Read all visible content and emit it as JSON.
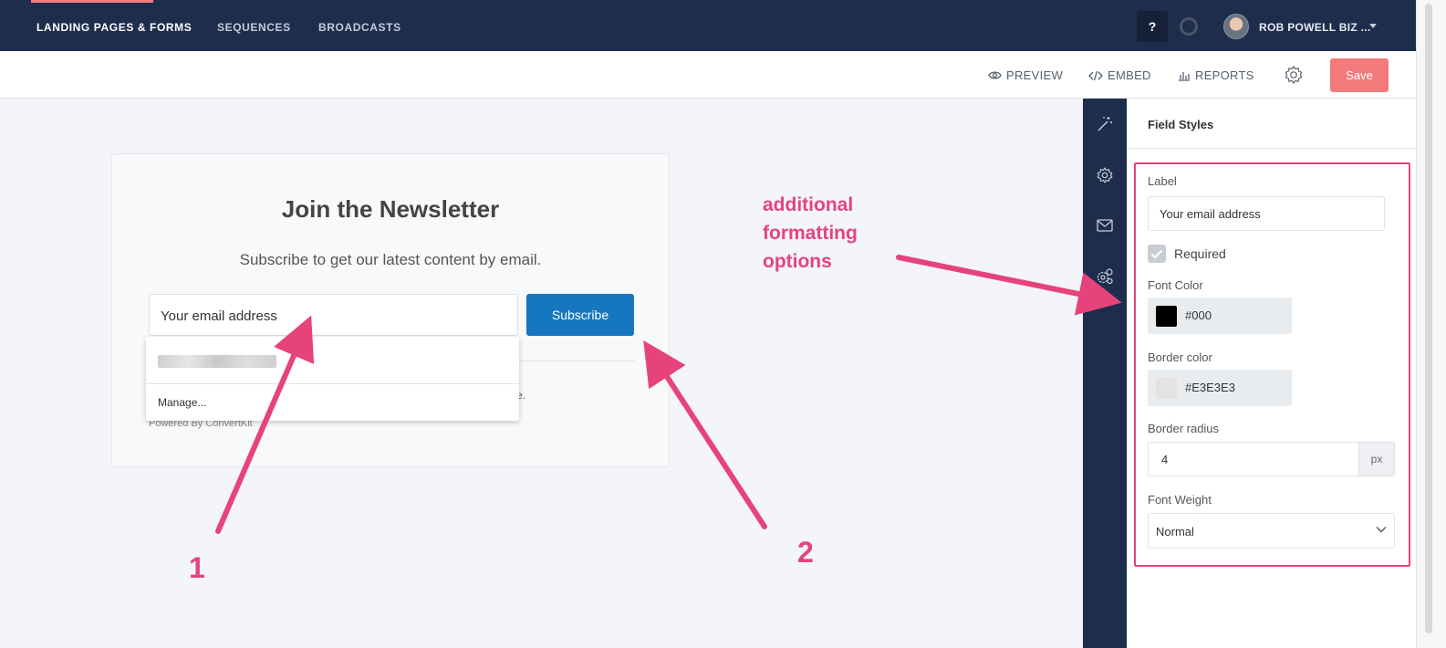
{
  "topnav": {
    "items": [
      {
        "label": "LANDING PAGES & FORMS",
        "active": true
      },
      {
        "label": "SEQUENCES",
        "active": false
      },
      {
        "label": "BROADCASTS",
        "active": false
      }
    ],
    "help_label": "?",
    "account_name": "ROB POWELL BIZ ..."
  },
  "toolbar": {
    "preview_label": "PREVIEW",
    "embed_label": "EMBED",
    "reports_label": "REPORTS",
    "save_label": "Save"
  },
  "form_preview": {
    "title": "Join the Newsletter",
    "subtitle": "Subscribe to get our latest content by email.",
    "email_placeholder": "Your email address",
    "subscribe_label": "Subscribe",
    "disclaimer_fragment": "e.",
    "powered_by": "Powered By ConvertKit"
  },
  "autofill": {
    "manage_label": "Manage..."
  },
  "field_styles": {
    "panel_title": "Field Styles",
    "label_heading": "Label",
    "label_value": "Your email address",
    "required_label": "Required",
    "required_checked": true,
    "font_color_heading": "Font Color",
    "font_color_value": "#000",
    "border_color_heading": "Border color",
    "border_color_value": "#E3E3E3",
    "border_radius_heading": "Border radius",
    "border_radius_value": "4",
    "border_radius_unit": "px",
    "font_weight_heading": "Font Weight",
    "font_weight_value": "Normal"
  },
  "annotations": {
    "callout_line1": "additional",
    "callout_line2": "formatting",
    "callout_line3": "options",
    "marker_1": "1",
    "marker_2": "2"
  },
  "colors": {
    "nav_bg": "#1f2d4d",
    "save": "#f27a7a",
    "subscribe": "#1677be",
    "annotation": "#e6437c"
  }
}
